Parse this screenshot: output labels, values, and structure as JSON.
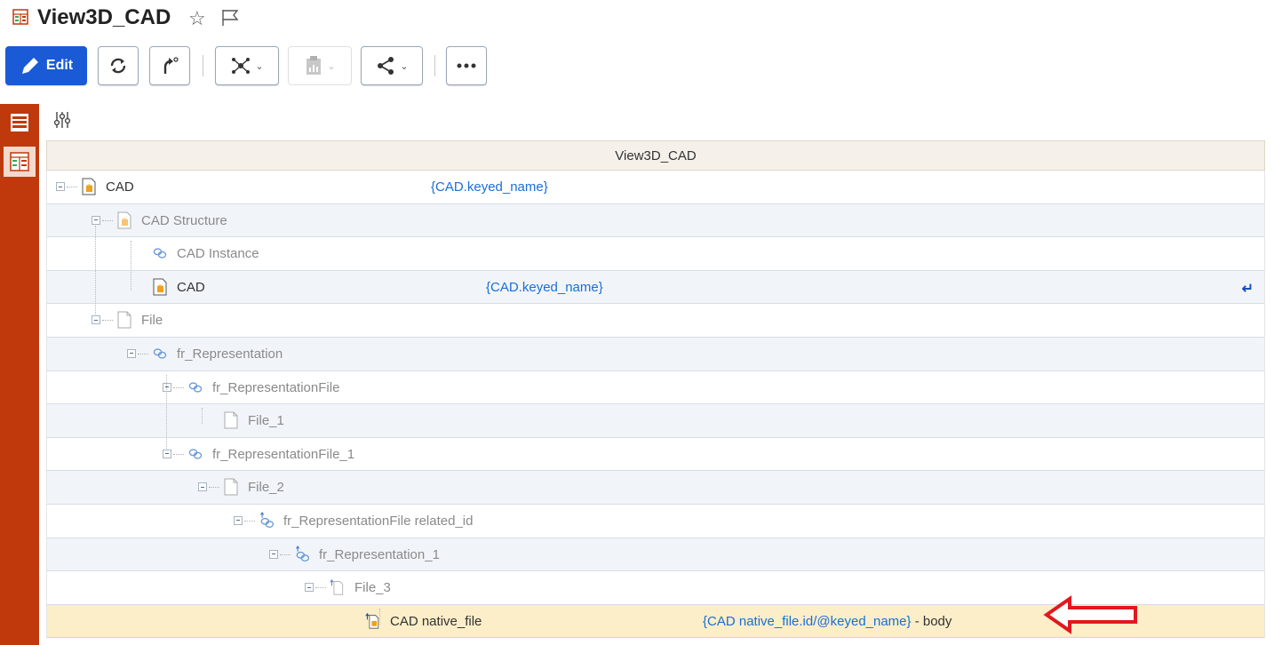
{
  "title": "View3D_CAD",
  "toolbar": {
    "edit_label": "Edit"
  },
  "grid": {
    "header": "View3D_CAD",
    "rows": [
      {
        "label": "CAD",
        "value": "{CAD.keyed_name}",
        "suffix": ""
      },
      {
        "label": "CAD Structure",
        "value": "",
        "suffix": ""
      },
      {
        "label": "CAD Instance",
        "value": "",
        "suffix": ""
      },
      {
        "label": "CAD",
        "value": "{CAD.keyed_name}",
        "suffix": ""
      },
      {
        "label": "File",
        "value": "",
        "suffix": ""
      },
      {
        "label": "fr_Representation",
        "value": "",
        "suffix": ""
      },
      {
        "label": "fr_RepresentationFile",
        "value": "",
        "suffix": ""
      },
      {
        "label": "File_1",
        "value": "",
        "suffix": ""
      },
      {
        "label": "fr_RepresentationFile_1",
        "value": "",
        "suffix": ""
      },
      {
        "label": "File_2",
        "value": "",
        "suffix": ""
      },
      {
        "label": "fr_RepresentationFile related_id",
        "value": "",
        "suffix": ""
      },
      {
        "label": "fr_Representation_1",
        "value": "",
        "suffix": ""
      },
      {
        "label": "File_3",
        "value": "",
        "suffix": ""
      },
      {
        "label": "CAD native_file",
        "value": "{CAD native_file.id/@keyed_name}",
        "suffix": " - body"
      }
    ]
  },
  "colors": {
    "accent": "#1a5ad7",
    "rail": "#c0390c",
    "link": "#1a6ed8",
    "selected_row": "#fbeec8",
    "annotation_arrow": "#e0191f"
  },
  "icons": [
    "form-icon",
    "star-icon",
    "flag-icon",
    "edit-pencil-icon",
    "refresh-icon",
    "undo-icon",
    "network-icon",
    "report-icon",
    "share-icon",
    "more-icon",
    "form-view-icon",
    "tree-view-icon",
    "settings-sliders-icon",
    "cad-item-icon",
    "relationship-icon",
    "file-icon",
    "return-icon"
  ]
}
